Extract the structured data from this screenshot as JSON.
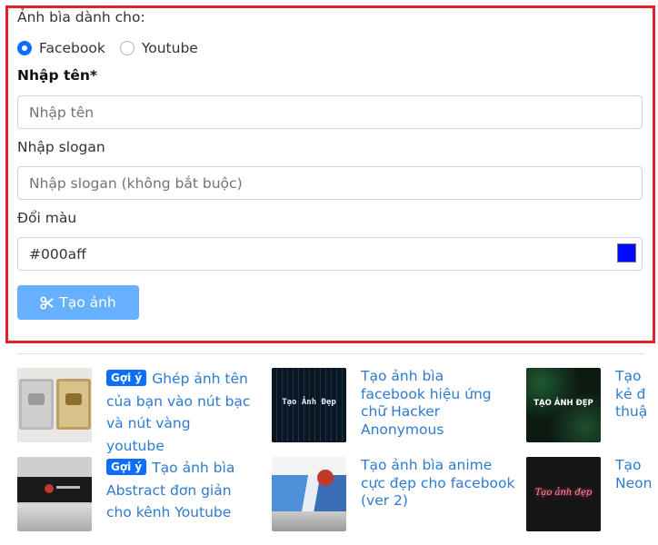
{
  "form": {
    "cover_for_label": "Ảnh bìa dành cho:",
    "platform_options": [
      {
        "label": "Facebook",
        "selected": true
      },
      {
        "label": "Youtube",
        "selected": false
      }
    ],
    "name_label": "Nhập tên*",
    "name_placeholder": "Nhập tên",
    "slogan_label": "Nhập slogan",
    "slogan_placeholder": "Nhập slogan (không bắt buộc)",
    "color_label": "Đổi màu",
    "color_value": "#000aff",
    "submit_label": "Tạo ảnh"
  },
  "related": [
    {
      "badge": "Gợi ý",
      "title": "Ghép ảnh tên của bạn vào nút bạc và nút vàng youtube",
      "thumb_icon": "play-button-awards-thumbnail"
    },
    {
      "badge": "",
      "title": "Tạo ảnh bìa facebook hiệu ứng chữ Hacker Anonymous",
      "thumb_icon": "hacker-text-thumbnail",
      "thumb_text": "Tạo Ảnh Đẹp"
    },
    {
      "badge": "",
      "title": "Tạo ... kẻ đ... thuậ...",
      "thumb_icon": "glitch-text-thumbnail",
      "thumb_text": "TẠO ẢNH ĐẸP",
      "lines": [
        "Tạo",
        "kẻ đ",
        "thuậ"
      ]
    },
    {
      "badge": "Gợi ý",
      "title": "Tạo ảnh bìa Abstract đơn giản cho kênh Youtube",
      "thumb_icon": "youtube-banner-thumbnail"
    },
    {
      "badge": "",
      "title": "Tạo ảnh bìa anime cực đẹp cho facebook (ver 2)",
      "thumb_icon": "anime-cover-thumbnail"
    },
    {
      "badge": "",
      "title": "Tạo Neon",
      "thumb_icon": "neon-text-thumbnail",
      "thumb_text": "Tạo ảnh đẹp",
      "lines": [
        "Tạo",
        "Neon"
      ]
    }
  ],
  "colors": {
    "frame": "#e0202c",
    "primary": "#0d6efd",
    "button": "#66b0ff",
    "link": "#2d7bd0"
  }
}
